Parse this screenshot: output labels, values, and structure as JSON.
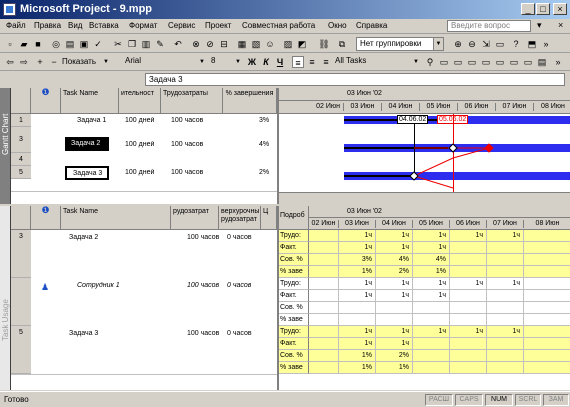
{
  "window": {
    "title": "Microsoft Project - 9.mpp"
  },
  "menu": [
    "Файл",
    "Правка",
    "Вид",
    "Вставка",
    "Формат",
    "Сервис",
    "Проект",
    "Совместная работа",
    "Окно",
    "Справка"
  ],
  "help_placeholder": "Введите вопрос",
  "toolbar": {
    "grouping": "Нет группировки",
    "show_label": "Показать",
    "font": "Arial",
    "size": "8",
    "filter": "All Tasks",
    "bold": "Ж",
    "italic": "К",
    "underline": "Ч"
  },
  "entry_value": "Задача 3",
  "gantt_table": {
    "headers": [
      "Task Name",
      "ительност",
      "Трудозатраты",
      "% завершения"
    ],
    "rows": [
      {
        "id": "1",
        "name": "Задача 1",
        "duration": "100 дней",
        "work": "100 часов",
        "pct": "3%"
      },
      {
        "id": "3",
        "name": "Задача 2",
        "duration": "100 дней",
        "work": "100 часов",
        "pct": "4%"
      },
      {
        "id": "4",
        "name": "",
        "duration": "",
        "work": "",
        "pct": ""
      },
      {
        "id": "5",
        "name": "Задача 3",
        "duration": "100 дней",
        "work": "100 часов",
        "pct": "2%"
      }
    ]
  },
  "gantt_chart": {
    "top_date": "03 Июн '02",
    "days": [
      "02 Июн",
      "03 Июн",
      "04 Июн",
      "05 Июн",
      "06 Июн",
      "07 Июн",
      "08 Июн"
    ],
    "label_left": "04.06.02",
    "label_right": "05.06.02"
  },
  "view_labels": {
    "top": "Gantt Chart",
    "bottom": "Task Usage"
  },
  "usage_table": {
    "headers": [
      "Task Name",
      "рудозатрат",
      "верхурочны рудозатрат",
      "Ц"
    ],
    "rows": [
      {
        "id": "3",
        "name": "Задача 2",
        "work": "100 часов",
        "ot": "0 часов"
      },
      {
        "id": "",
        "name": "Сотрудник 1",
        "work": "100 часов",
        "ot": "0 часов"
      },
      {
        "id": "5",
        "name": "Задача 3",
        "work": "100 часов",
        "ot": "0 часов"
      }
    ]
  },
  "usage_grid": {
    "detail_header": "Подроб",
    "top_date": "03 Июн '02",
    "days": [
      "02 Июн",
      "03 Июн",
      "04 Июн",
      "05 Июн",
      "06 Июн",
      "07 Июн",
      "08 Июн"
    ],
    "rows": [
      {
        "label": "Трудо:",
        "vals": [
          "",
          "1ч",
          "1ч",
          "1ч",
          "1ч",
          "1ч",
          ""
        ],
        "yellow": true
      },
      {
        "label": "Факт. ",
        "vals": [
          "",
          "1ч",
          "1ч",
          "1ч",
          "",
          "",
          ""
        ],
        "yellow": true
      },
      {
        "label": "Сов. %",
        "vals": [
          "",
          "3%",
          "4%",
          "4%",
          "",
          "",
          ""
        ],
        "yellow": true
      },
      {
        "label": "% заве",
        "vals": [
          "",
          "1%",
          "2%",
          "1%",
          "",
          "",
          ""
        ],
        "yellow": true
      },
      {
        "label": "Трудо:",
        "vals": [
          "",
          "1ч",
          "1ч",
          "1ч",
          "1ч",
          "1ч",
          ""
        ],
        "yellow": false
      },
      {
        "label": "Факт. ",
        "vals": [
          "",
          "1ч",
          "1ч",
          "1ч",
          "",
          "",
          ""
        ],
        "yellow": false
      },
      {
        "label": "Сов. %",
        "vals": [
          "",
          "",
          "",
          "",
          "",
          "",
          ""
        ],
        "yellow": false
      },
      {
        "label": "% заве",
        "vals": [
          "",
          "",
          "",
          "",
          "",
          "",
          ""
        ],
        "yellow": false
      },
      {
        "label": "Трудо:",
        "vals": [
          "",
          "1ч",
          "1ч",
          "1ч",
          "1ч",
          "1ч",
          ""
        ],
        "yellow": true
      },
      {
        "label": "Факт. ",
        "vals": [
          "",
          "1ч",
          "1ч",
          "",
          "",
          "",
          ""
        ],
        "yellow": true
      },
      {
        "label": "Сов. %",
        "vals": [
          "",
          "1%",
          "2%",
          "",
          "",
          "",
          ""
        ],
        "yellow": true
      },
      {
        "label": "% заве",
        "vals": [
          "",
          "1%",
          "1%",
          "",
          "",
          "",
          ""
        ],
        "yellow": true
      }
    ]
  },
  "status": {
    "ready": "Готово",
    "indicators": [
      "РАСШ",
      "CAPS",
      "NUM",
      "SCRL",
      "ЗАМ"
    ]
  }
}
